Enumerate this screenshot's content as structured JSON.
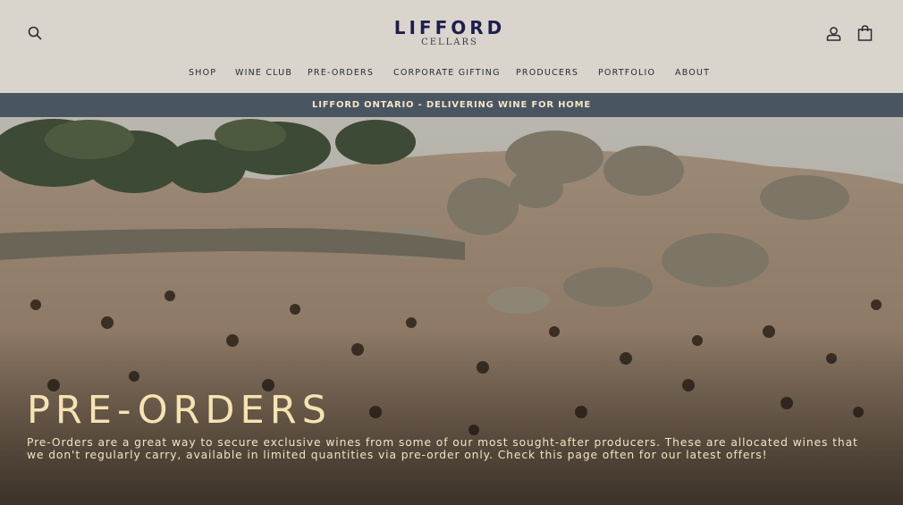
{
  "header": {
    "logo": {
      "name": "LIFFORD",
      "sub": "CELLARS"
    },
    "icons": {
      "search": "search-icon",
      "account": "account-icon",
      "cart": "cart-icon"
    },
    "nav": [
      "SHOP",
      "WINE CLUB",
      "PRE-ORDERS",
      "CORPORATE GIFTING",
      "PRODUCERS",
      "PORTFOLIO",
      "ABOUT"
    ]
  },
  "announcement": {
    "text": "LIFFORD ONTARIO - DELIVERING WINE FOR HOME"
  },
  "hero": {
    "title": "PRE-ORDERS",
    "description": "Pre-Orders are a great way to secure exclusive wines from some of our most sought-after producers. These are allocated wines that we don't regularly carry, available in limited quantities via pre-order only. Check this page often for our latest offers!"
  },
  "colors": {
    "header_bg": "#d9d5cc",
    "brand_navy": "#1d1e4f",
    "announcement_bg": "#4a5562",
    "announcement_text": "#f2e6c7",
    "hero_title": "#f6e3b2"
  }
}
